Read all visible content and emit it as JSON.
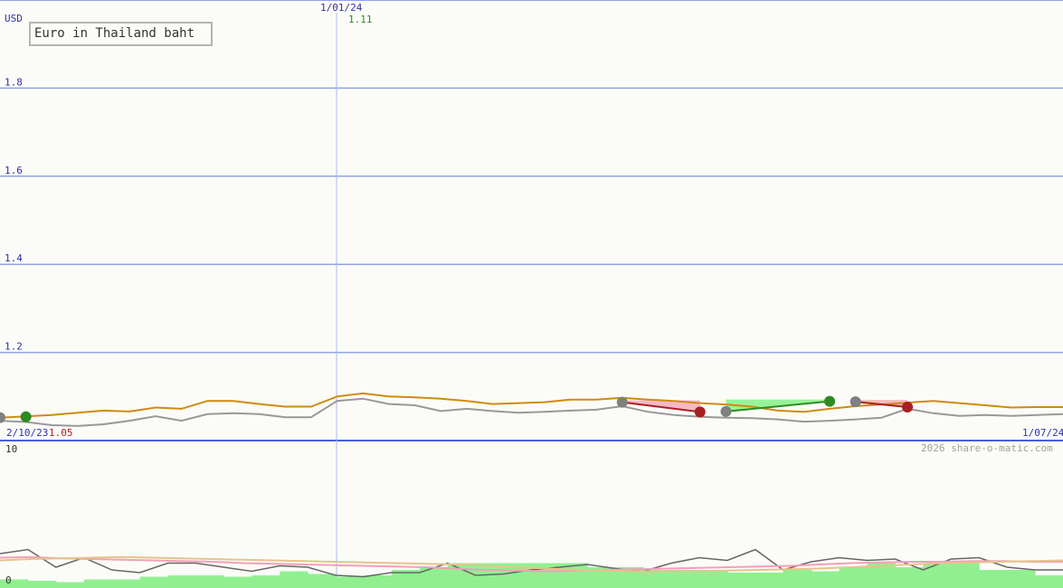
{
  "title": "Euro in Thailand baht",
  "currency_label": "USD",
  "watermark": "2026 share-o-matic.com",
  "colors": {
    "background": "#fbfcf8",
    "grid": "#8fa3ea",
    "price": "#d08a10",
    "price_shadow": "#999999",
    "volatility": "#666666",
    "ma_pink": "#f2a0b8",
    "ma_tan": "#e4c48c",
    "volume": "#90f090",
    "buy_marker": "#2e8b22",
    "sell_marker": "#a82020",
    "neutral_marker": "#808080",
    "gain_fill": "#80f080",
    "loss_fill": "#f4a8b8",
    "axis_text": "#3030b0"
  },
  "chart_data": [
    {
      "type": "line",
      "panel": "price",
      "y_axis_label": "USD",
      "ylim": [
        1.0,
        2.0
      ],
      "y_ticks": [
        "1.8",
        "1.6",
        "1.4",
        "1.2"
      ],
      "x_date_labels": [
        "2/10/23",
        "1/01/24",
        "1/07/24"
      ],
      "annotations": [
        {
          "text": "1.11",
          "at": "1/01/24",
          "color": "#2e8b22"
        },
        {
          "text": "1.05",
          "at": "2/10/23",
          "color": "#a82020"
        }
      ],
      "series": [
        {
          "values": [
            1.052,
            1.055,
            1.058,
            1.063,
            1.068,
            1.066,
            1.075,
            1.072,
            1.09,
            1.09,
            1.083,
            1.077,
            1.077,
            1.1,
            1.107,
            1.1,
            1.098,
            1.095,
            1.09,
            1.083,
            1.085,
            1.087,
            1.093,
            1.093,
            1.097,
            1.093,
            1.09,
            1.085,
            1.082,
            1.077,
            1.068,
            1.065,
            1.072,
            1.078,
            1.082,
            1.086,
            1.09,
            1.085,
            1.08,
            1.075,
            1.076,
            1.076
          ]
        },
        {
          "values": [
            1.045,
            1.042,
            1.035,
            1.033,
            1.037,
            1.045,
            1.055,
            1.045,
            1.06,
            1.062,
            1.06,
            1.053,
            1.053,
            1.09,
            1.095,
            1.083,
            1.08,
            1.067,
            1.072,
            1.067,
            1.063,
            1.065,
            1.068,
            1.07,
            1.078,
            1.065,
            1.058,
            1.054,
            1.052,
            1.051,
            1.048,
            1.043,
            1.045,
            1.048,
            1.052,
            1.072,
            1.062,
            1.056,
            1.058,
            1.056,
            1.058,
            1.06
          ]
        }
      ],
      "markers": [
        {
          "index": 0,
          "value": 1.052,
          "kind": "neutral"
        },
        {
          "index": 1,
          "value": 1.054,
          "kind": "buy"
        },
        {
          "index": 24,
          "value": 1.087,
          "kind": "neutral"
        },
        {
          "index": 27,
          "value": 1.065,
          "kind": "sell"
        },
        {
          "index": 28,
          "value": 1.066,
          "kind": "neutral"
        },
        {
          "index": 32,
          "value": 1.089,
          "kind": "buy"
        },
        {
          "index": 33,
          "value": 1.088,
          "kind": "neutral"
        },
        {
          "index": 35,
          "value": 1.076,
          "kind": "sell"
        }
      ]
    },
    {
      "type": "line",
      "panel": "indicator",
      "ylim": [
        0,
        10
      ],
      "y_ticks": [
        "10",
        "0"
      ],
      "series": [
        {
          "values": [
            2.2,
            2.5,
            1.2,
            1.9,
            1.0,
            0.8,
            1.5,
            1.5,
            1.2,
            0.9,
            1.3,
            1.2,
            0.6,
            0.5,
            0.8,
            0.8,
            1.5,
            0.6,
            0.7,
            1.0,
            1.2,
            1.4,
            1.1,
            0.9,
            1.5,
            1.9,
            1.7,
            2.5,
            1.0,
            1.6,
            1.9,
            1.7,
            1.8,
            1.0,
            1.8,
            1.9,
            1.2,
            1.0,
            1.0
          ]
        },
        {
          "values": [
            1.9,
            1.95,
            1.85,
            1.8,
            1.75,
            1.7,
            1.65,
            1.6,
            1.5,
            1.45,
            1.4,
            1.35,
            1.3,
            1.25,
            1.2,
            1.1,
            1.0,
            0.95,
            0.9,
            0.95,
            1.0,
            1.05,
            1.1,
            1.15,
            1.2,
            1.25,
            1.3,
            1.4,
            1.5,
            1.55,
            1.6,
            1.6,
            1.65,
            1.65,
            1.6,
            1.6
          ]
        },
        {
          "values": [
            1.7,
            1.8,
            1.85,
            1.9,
            1.95,
            1.9,
            1.85,
            1.8,
            1.75,
            1.7,
            1.65,
            1.6,
            1.55,
            1.5,
            1.45,
            1.4,
            1.3,
            1.2,
            1.1,
            1.0,
            0.95,
            0.9,
            0.9,
            0.9,
            0.95,
            1.0,
            1.05,
            1.1,
            1.2,
            1.3,
            1.4,
            1.5,
            1.55,
            1.6,
            1.65,
            1.7
          ]
        }
      ],
      "volume": [
        0.3,
        0.2,
        0.1,
        0.3,
        0.3,
        0.5,
        0.6,
        0.6,
        0.5,
        0.6,
        0.9,
        0.7,
        0.5,
        0.6,
        1.0,
        1.2,
        1.5,
        1.5,
        1.5,
        1.5,
        1.5,
        1.2,
        1.2,
        1.0,
        1.0,
        1.0,
        0.8,
        0.8,
        1.0,
        0.9,
        1.2,
        1.5,
        1.2,
        1.5,
        1.5,
        1.0,
        1.0,
        0.6
      ]
    }
  ]
}
